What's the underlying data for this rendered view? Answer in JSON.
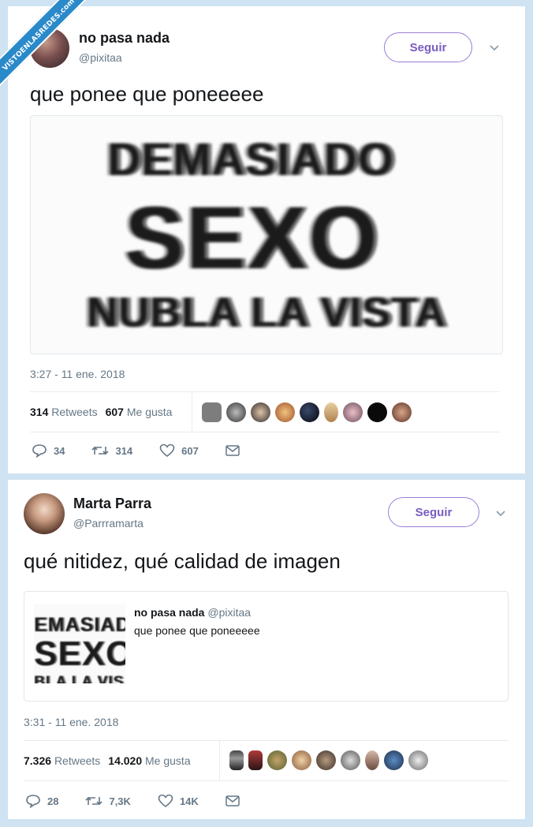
{
  "watermark": "VISTOENLASREDES.com",
  "tweet1": {
    "name": "no pasa nada",
    "handle": "@pixitaa",
    "follow_label": "Seguir",
    "text": "que ponee que poneeeee",
    "image_text": [
      "DEMASIADO",
      "SEXO",
      "NUBLA LA VISTA"
    ],
    "timestamp": "3:27 - 11 ene. 2018",
    "retweets_count": "314",
    "retweets_label": "Retweets",
    "likes_count": "607",
    "likes_label": "Me gusta",
    "actions": {
      "replies": "34",
      "retweets": "314",
      "likes": "607"
    }
  },
  "tweet2": {
    "name": "Marta Parra",
    "handle": "@Parrramarta",
    "follow_label": "Seguir",
    "text": "qué nitidez, qué calidad de imagen",
    "quote": {
      "name": "no pasa nada",
      "handle": "@pixitaa",
      "text": "que ponee que poneeeee",
      "thumb_text": [
        "EMASIADO",
        "SEXO",
        "BLA LA VIS"
      ]
    },
    "timestamp": "3:31 - 11 ene. 2018",
    "retweets_count": "7.326",
    "retweets_label": "Retweets",
    "likes_count": "14.020",
    "likes_label": "Me gusta",
    "actions": {
      "replies": "28",
      "retweets": "7,3K",
      "likes": "14K"
    }
  },
  "colors": {
    "accent_follow": "#7a5cc0",
    "muted": "#657786",
    "ribbon": "#2a89c9",
    "background": "#cfe3f2"
  }
}
